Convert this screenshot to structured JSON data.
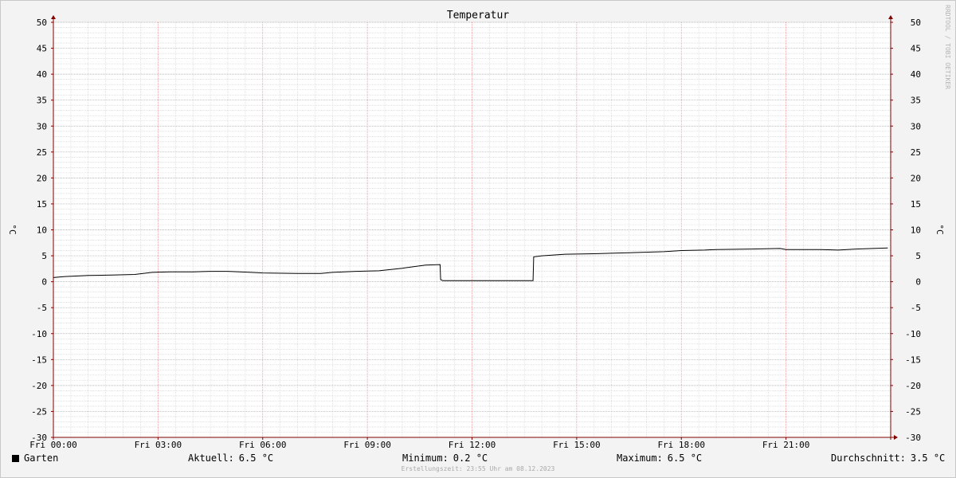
{
  "chart_data": {
    "type": "line",
    "title": "Temperatur",
    "ylabel_left": "°C",
    "ylabel_right": "°C",
    "ylim": [
      -30,
      50
    ],
    "y_ticks": [
      50,
      45,
      40,
      35,
      30,
      25,
      20,
      15,
      10,
      5,
      0,
      -5,
      -10,
      -15,
      -20,
      -25,
      -30
    ],
    "y_tick_labels": [
      "50",
      "45",
      "40",
      "35",
      "30",
      "25",
      "20",
      "15",
      "10",
      "5",
      "0",
      "-5",
      "-10",
      "-15",
      "-20",
      "-25",
      "-30"
    ],
    "xlim": [
      "Fri 00:00",
      "Fri 24:00"
    ],
    "x_ticks_hours": [
      0,
      3,
      6,
      9,
      12,
      15,
      18,
      21
    ],
    "x_tick_labels": [
      "Fri 00:00",
      "Fri 03:00",
      "Fri 06:00",
      "Fri 09:00",
      "Fri 12:00",
      "Fri 15:00",
      "Fri 18:00",
      "Fri 21:00"
    ],
    "grid": true,
    "series": [
      {
        "name": "Garten",
        "color": "#000000",
        "points": [
          [
            "Fri 00:00",
            0.8
          ],
          [
            "Fri 00:20",
            1.0
          ],
          [
            "Fri 01:00",
            1.2
          ],
          [
            "Fri 01:40",
            1.3
          ],
          [
            "Fri 02:20",
            1.4
          ],
          [
            "Fri 02:50",
            1.8
          ],
          [
            "Fri 03:20",
            1.9
          ],
          [
            "Fri 04:00",
            1.9
          ],
          [
            "Fri 04:30",
            2.0
          ],
          [
            "Fri 05:00",
            2.0
          ],
          [
            "Fri 05:40",
            1.8
          ],
          [
            "Fri 06:00",
            1.7
          ],
          [
            "Fri 07:00",
            1.6
          ],
          [
            "Fri 07:40",
            1.6
          ],
          [
            "Fri 08:00",
            1.8
          ],
          [
            "Fri 08:40",
            2.0
          ],
          [
            "Fri 09:20",
            2.1
          ],
          [
            "Fri 10:00",
            2.6
          ],
          [
            "Fri 10:40",
            3.2
          ],
          [
            "Fri 11:05",
            3.3
          ],
          [
            "Fri 11:06",
            0.4
          ],
          [
            "Fri 11:10",
            0.2
          ],
          [
            "Fri 12:00",
            0.2
          ],
          [
            "Fri 13:00",
            0.2
          ],
          [
            "Fri 13:45",
            0.2
          ],
          [
            "Fri 13:46",
            4.8
          ],
          [
            "Fri 14:00",
            5.0
          ],
          [
            "Fri 14:40",
            5.3
          ],
          [
            "Fri 15:30",
            5.4
          ],
          [
            "Fri 16:30",
            5.6
          ],
          [
            "Fri 17:30",
            5.8
          ],
          [
            "Fri 18:00",
            6.0
          ],
          [
            "Fri 18:40",
            6.1
          ],
          [
            "Fri 19:00",
            6.2
          ],
          [
            "Fri 20:00",
            6.3
          ],
          [
            "Fri 20:50",
            6.4
          ],
          [
            "Fri 21:00",
            6.2
          ],
          [
            "Fri 22:00",
            6.2
          ],
          [
            "Fri 22:30",
            6.1
          ],
          [
            "Fri 23:00",
            6.3
          ],
          [
            "Fri 23:55",
            6.5
          ]
        ]
      }
    ]
  },
  "legend": {
    "name": "Garten"
  },
  "stats": {
    "current_label": "Aktuell:",
    "current_value": "6.5 °C",
    "min_label": "Minimum:",
    "min_value": "0.2 °C",
    "max_label": "Maximum:",
    "max_value": "6.5 °C",
    "avg_label": "Durchschnitt:",
    "avg_value": "3.5 °C"
  },
  "watermark": "RRDTOOL / TOBI OETIKER",
  "credit": "Erstellungszeit: 23:55 Uhr am 08.12.2023",
  "colors": {
    "major_grid": "#f08080",
    "minor_grid": "#cfcfcf",
    "axis": "#800000",
    "line": "#000000",
    "plot_bg": "#ffffff",
    "page_bg": "#f3f3f3"
  }
}
